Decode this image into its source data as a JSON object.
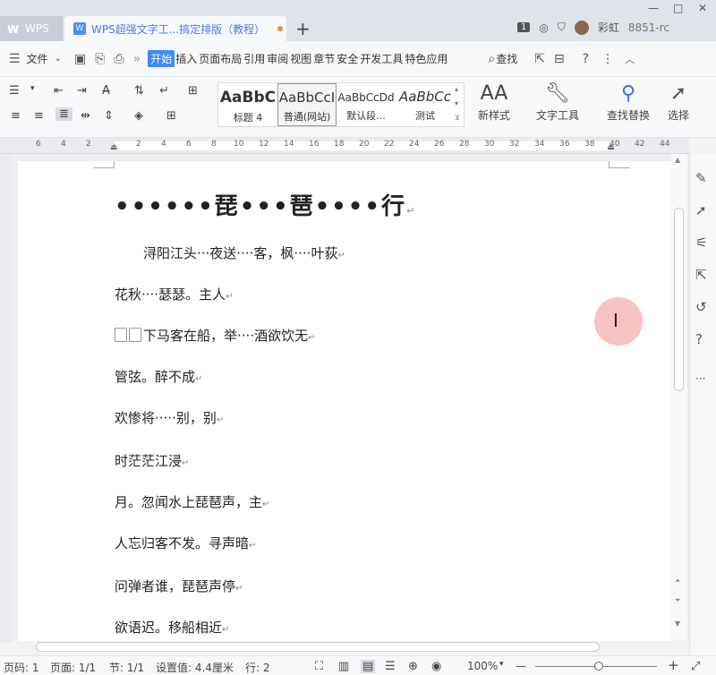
{
  "titlebar": {
    "app_tab": "WPS",
    "doc_tab": "WPS超强文字工...搞定排版（教程）",
    "new_tab": "+",
    "badge": "1",
    "user_name": "彩虹",
    "user_id": "8851-rc",
    "minimize": "—",
    "maximize": "□",
    "close": "✕"
  },
  "menubar": {
    "file": "文件",
    "items": [
      "开始",
      "插入",
      "页面布局",
      "引用",
      "审阅",
      "视图",
      "章节",
      "安全",
      "开发工具",
      "特色应用"
    ],
    "search": "查找",
    "help": "?",
    "more": "⋮"
  },
  "ribbon": {
    "styles": [
      {
        "sample": "AaBbC",
        "name": "标题 4"
      },
      {
        "sample": "AaBbCcI",
        "name": "普通(网站)"
      },
      {
        "sample": "AaBbCcDd",
        "name": "默认段..."
      },
      {
        "sample": "AaBbCc",
        "name": "测试"
      }
    ],
    "new_style": "新样式",
    "text_tools": "文字工具",
    "find_replace": "查找替换",
    "select": "选择"
  },
  "ruler": {
    "labels": [
      "6",
      "4",
      "2",
      "2",
      "4",
      "6",
      "8",
      "10",
      "12",
      "14",
      "16",
      "18",
      "20",
      "22",
      "24",
      "26",
      "28",
      "30",
      "32",
      "34",
      "36",
      "38",
      "40",
      "42",
      "44"
    ]
  },
  "document": {
    "title": "••••••琵•••琶••••行",
    "lines": [
      "浔阳江头···夜送····客，枫····叶荻",
      "花秋····瑟瑟。主人",
      "下马客在船，举····酒欲饮无",
      "管弦。醉不成",
      "欢惨将·····别，别",
      "时茫茫江浸",
      "月。忽闻水上琵琶声，主",
      "人忘归客不发。寻声暗",
      "问弹者谁，琵琶声停",
      "欲语迟。移船相近"
    ],
    "para_mark": "↵"
  },
  "status": {
    "page_num": "页码: 1",
    "pages": "页面: 1/1",
    "section": "节: 1/1",
    "setting": "设置值: 4.4厘米",
    "row": "行: 2",
    "zoom": "100%",
    "zoom_minus": "—",
    "zoom_plus": "+"
  },
  "colors": {
    "accent": "#3d8af7",
    "cursor_highlight": "#f07878"
  }
}
